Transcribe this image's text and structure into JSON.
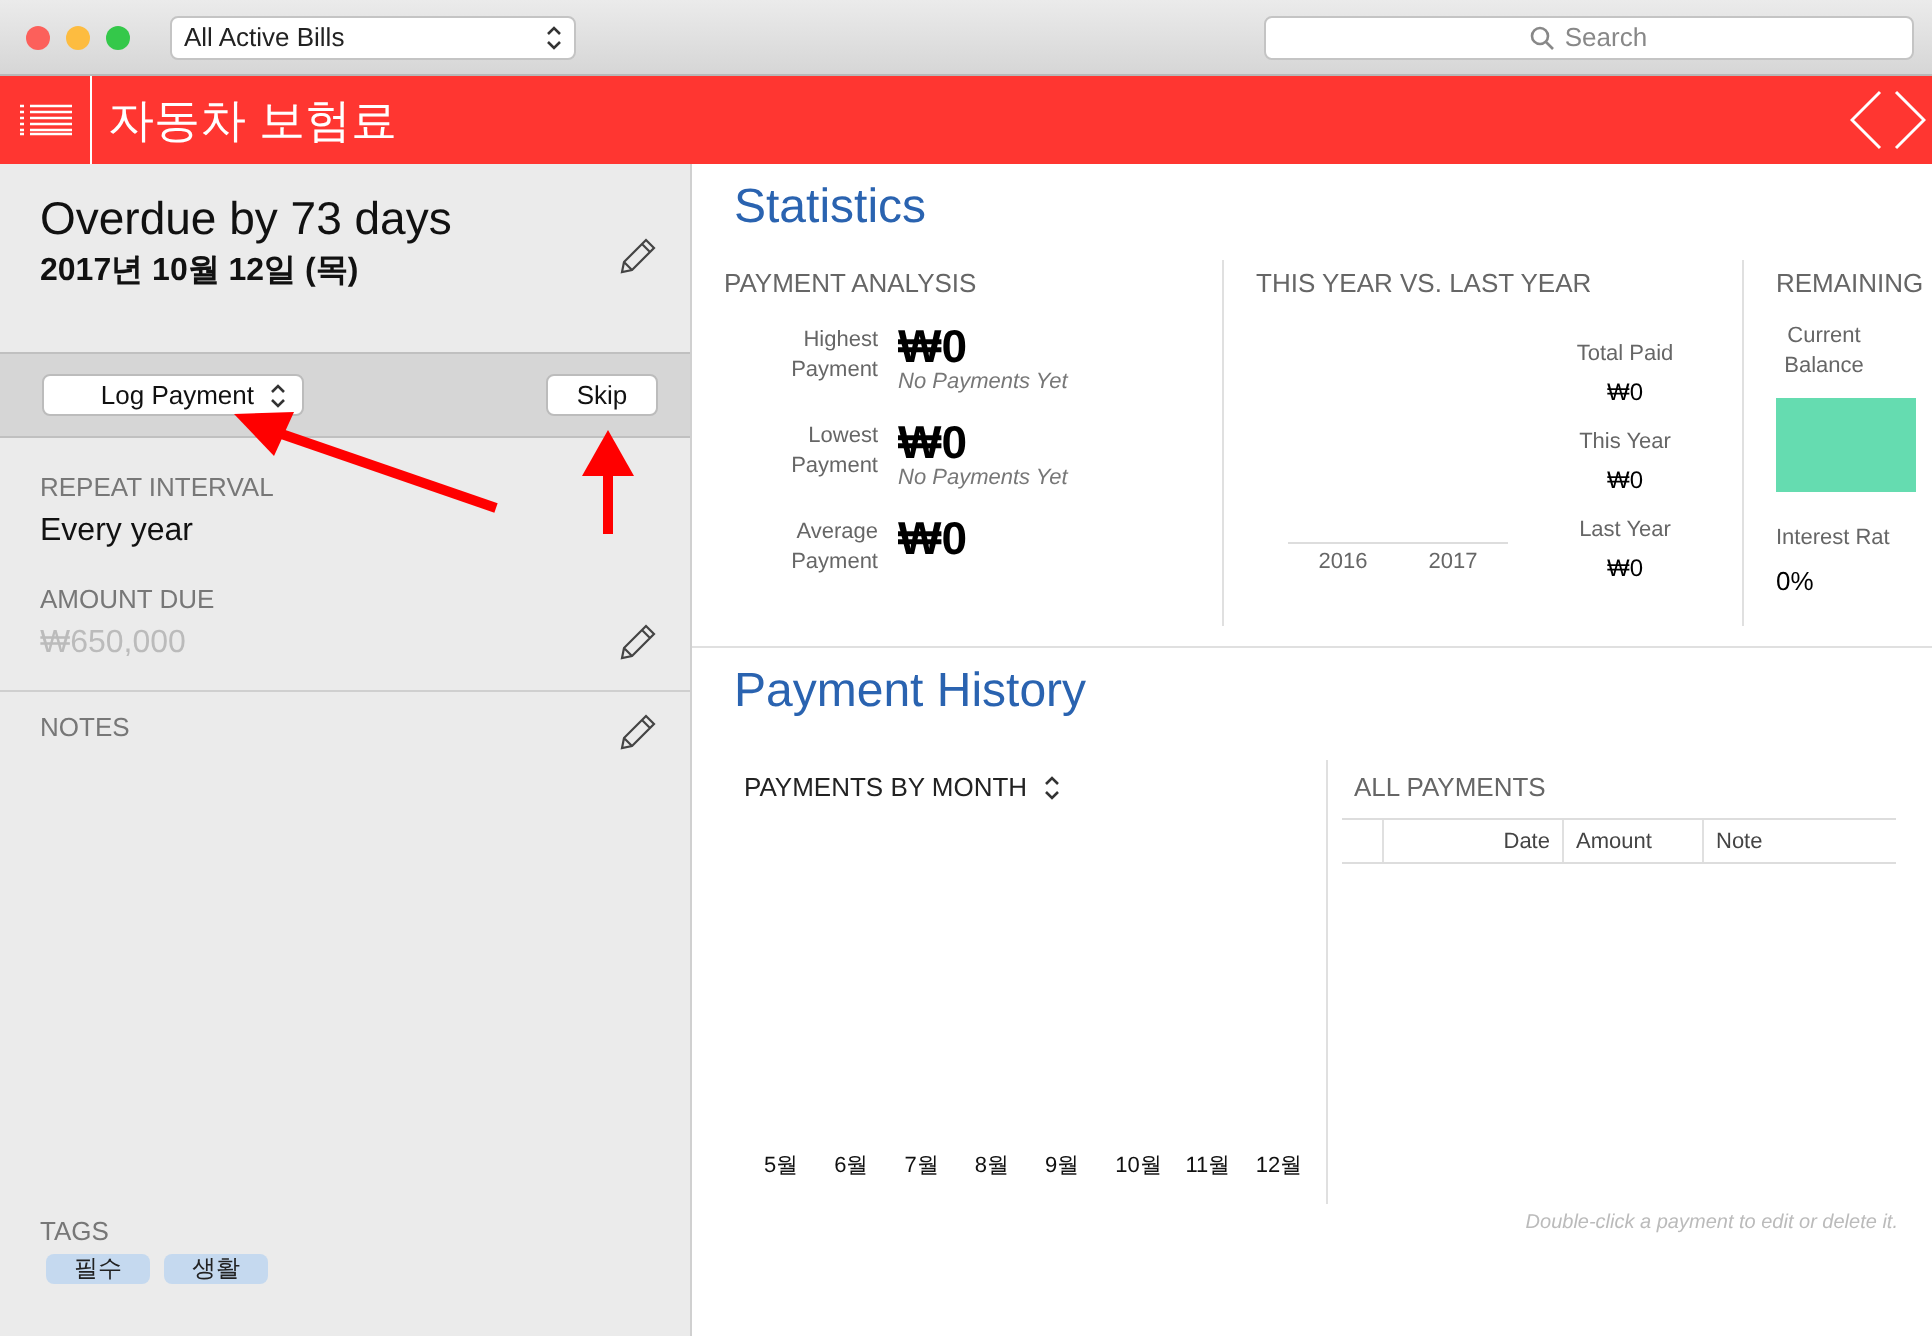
{
  "toolbar": {
    "bill_filter": "All Active Bills",
    "search": {
      "placeholder": "Search"
    }
  },
  "header": {
    "title": "자동차 보험료"
  },
  "bill": {
    "status": "Overdue by 73 days",
    "due_date": "2017년 10월 12일 (목)",
    "actions": {
      "log_payment": "Log Payment",
      "skip": "Skip"
    },
    "repeat_interval": {
      "label": "REPEAT INTERVAL",
      "value": "Every year"
    },
    "amount_due": {
      "label": "AMOUNT DUE",
      "value": "₩650,000"
    },
    "notes": {
      "label": "NOTES"
    },
    "tags": {
      "label": "TAGS",
      "items": [
        "필수",
        "생활"
      ]
    }
  },
  "statistics": {
    "title": "Statistics",
    "payment_analysis": {
      "title": "PAYMENT ANALYSIS",
      "rows": [
        {
          "label": "Highest Payment",
          "value": "₩0",
          "note": "No Payments Yet"
        },
        {
          "label": "Lowest Payment",
          "value": "₩0",
          "note": "No Payments Yet"
        },
        {
          "label": "Average Payment",
          "value": "₩0"
        }
      ]
    },
    "year_compare": {
      "title": "THIS YEAR VS. LAST YEAR",
      "years": [
        "2016",
        "2017"
      ],
      "stats": [
        {
          "label": "Total Paid",
          "value": "₩0"
        },
        {
          "label": "This Year",
          "value": "₩0"
        },
        {
          "label": "Last Year",
          "value": "₩0"
        }
      ]
    },
    "remaining": {
      "title": "REMAINING",
      "balance_label": "Current Balance",
      "rate_label": "Interest Rat",
      "rate_value": "0%"
    }
  },
  "payment_history": {
    "title": "Payment History",
    "by_month": {
      "title": "PAYMENTS BY MONTH",
      "months": [
        "5월",
        "6월",
        "7월",
        "8월",
        "9월",
        "10월",
        "11월",
        "12월"
      ]
    },
    "all_payments": {
      "title": "ALL PAYMENTS",
      "columns": [
        "Date",
        "Amount",
        "Note"
      ]
    },
    "hint": "Double-click a payment to edit or delete it."
  }
}
